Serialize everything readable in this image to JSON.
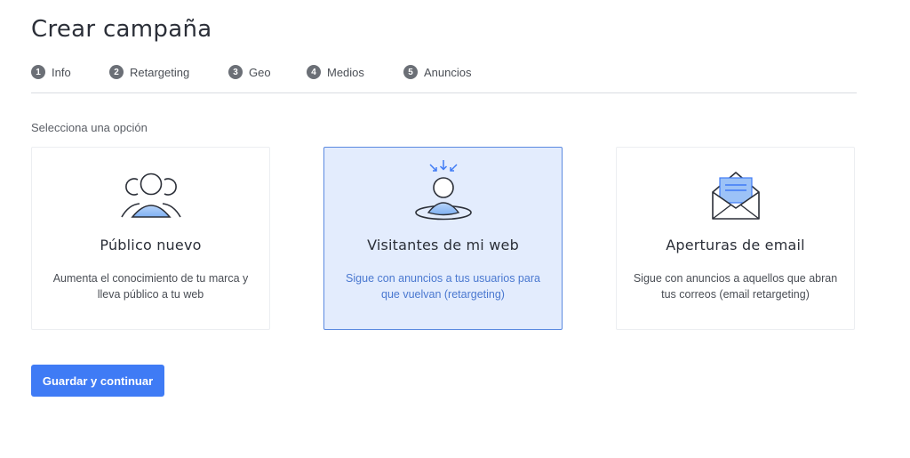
{
  "header": {
    "title": "Crear campaña"
  },
  "steps": [
    {
      "number": "1",
      "label": "Info"
    },
    {
      "number": "2",
      "label": "Retargeting"
    },
    {
      "number": "3",
      "label": "Geo"
    },
    {
      "number": "4",
      "label": "Medios"
    },
    {
      "number": "5",
      "label": "Anuncios"
    }
  ],
  "prompt": "Selecciona una opción",
  "options": [
    {
      "icon": "audience-group-icon",
      "title": "Público nuevo",
      "description": "Aumenta el conocimiento de tu marca y lleva público a tu web",
      "selected": false
    },
    {
      "icon": "returning-visitor-icon",
      "title": "Visitantes de mi web",
      "description": "Sigue con anuncios a tus usuarios para que vuelvan (retargeting)",
      "selected": true
    },
    {
      "icon": "open-envelope-icon",
      "title": "Aperturas de email",
      "description": "Sigue con anuncios a aquellos que abran tus correos (email retargeting)",
      "selected": false
    }
  ],
  "actions": {
    "save_continue_label": "Guardar y continuar"
  },
  "colors": {
    "accent": "#3f7bf5",
    "selected_bg": "#e3ecfd",
    "selected_border": "#5b8ae0",
    "icon_fill": "#9cc2f7",
    "icon_stroke": "#2b2f38"
  }
}
